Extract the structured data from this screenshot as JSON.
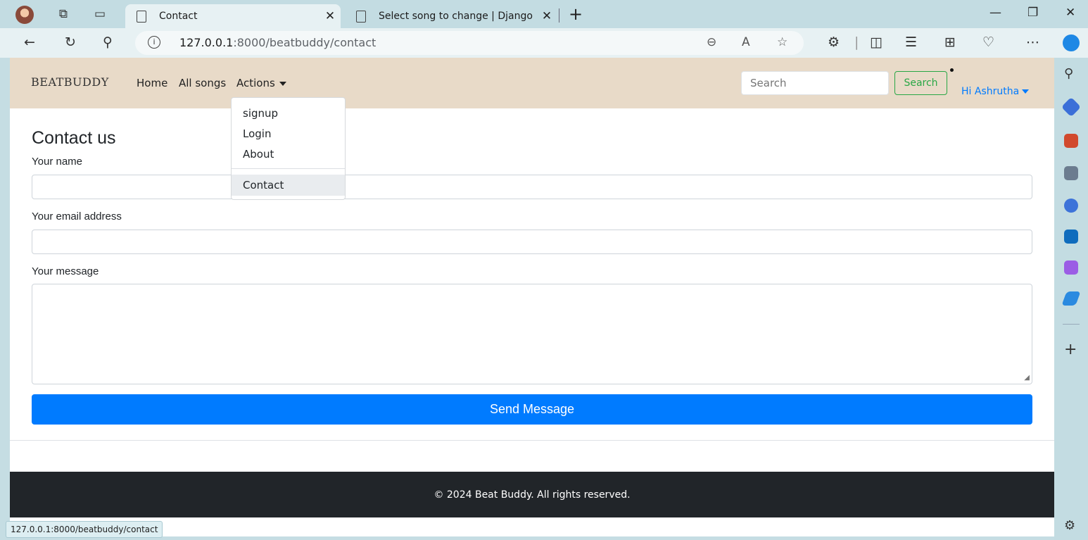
{
  "browser": {
    "tabs": [
      {
        "title": "Contact",
        "active": true
      },
      {
        "title": "Select song to change | Django s",
        "active": false
      }
    ],
    "address": {
      "host": "127.0.0.1",
      "path": ":8000/beatbuddy/contact"
    },
    "status_url": "127.0.0.1:8000/beatbuddy/contact"
  },
  "navbar": {
    "brand": "BEATBUDDY",
    "links": [
      "Home",
      "All songs",
      "Actions"
    ],
    "search": {
      "placeholder": "Search",
      "button": "Search"
    },
    "user": "Hi Ashrutha"
  },
  "dropdown": {
    "items": [
      "signup",
      "Login",
      "About"
    ],
    "highlighted": "Contact"
  },
  "form": {
    "heading": "Contact us",
    "name_label": "Your name",
    "email_label": "Your email address",
    "message_label": "Your message",
    "submit": "Send Message"
  },
  "footer": {
    "text": "© 2024 Beat Buddy. All rights reserved."
  },
  "colors": {
    "primary": "#007bff",
    "success": "#28a745",
    "navbar": "#e8dac8",
    "footer": "#212529"
  }
}
